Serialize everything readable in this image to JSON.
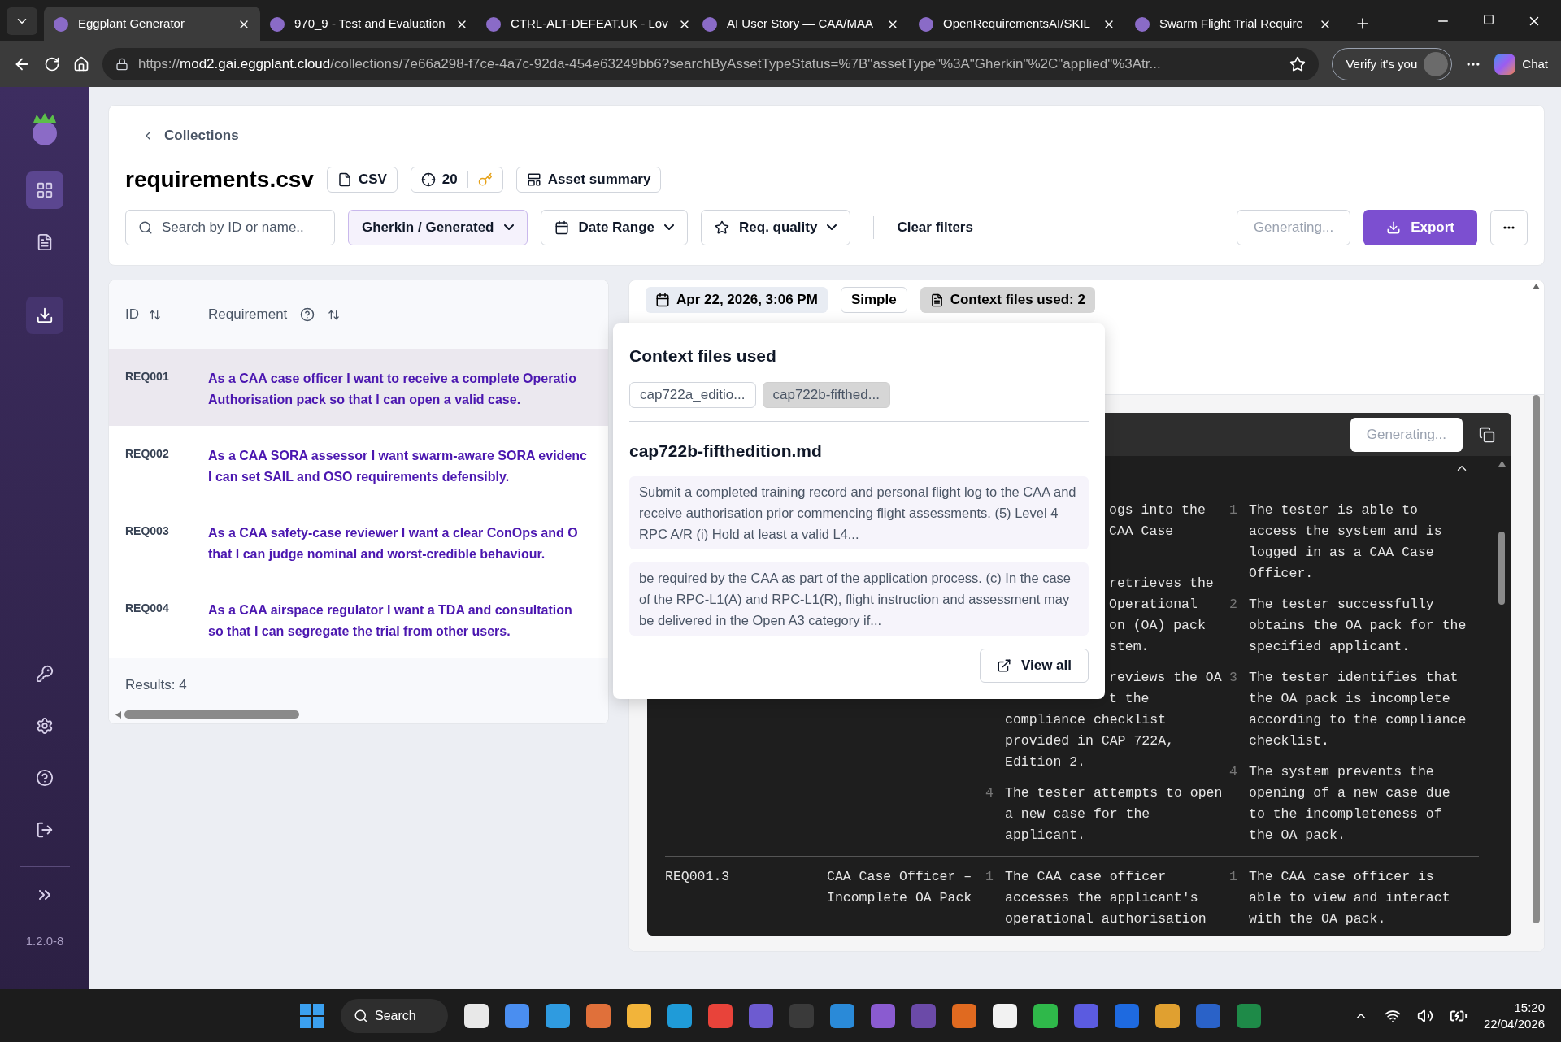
{
  "browser": {
    "tabs": [
      {
        "title": "Eggplant Generator",
        "selected": true
      },
      {
        "title": "970_9 - Test and Evaluation",
        "selected": false
      },
      {
        "title": "CTRL-ALT-DEFEAT.UK - Lov",
        "selected": false
      },
      {
        "title": "AI User Story — CAA/MAA",
        "selected": false
      },
      {
        "title": "OpenRequirementsAI/SKIL",
        "selected": false
      },
      {
        "title": "Swarm Flight Trial Require",
        "selected": false
      }
    ],
    "url_scheme": "https://",
    "url_host": "mod2.gai.eggplant.cloud",
    "url_rest": "/collections/7e66a298-f7ce-4a7c-92da-454e63249bb6?searchByAssetTypeStatus=%7B\"assetType\"%3A\"Gherkin\"%2C\"applied\"%3Atr...",
    "verify": "Verify it's you",
    "chat": "Chat"
  },
  "sidebar": {
    "items": [
      {
        "kind": "apps",
        "selected": true,
        "hovered": false
      },
      {
        "kind": "document",
        "selected": false,
        "hovered": false
      },
      {
        "kind": "import",
        "selected": false,
        "hovered": true
      }
    ],
    "bottom_items": [
      {
        "kind": "key"
      },
      {
        "kind": "settings"
      },
      {
        "kind": "help"
      },
      {
        "kind": "logout"
      }
    ],
    "version": "1.2.0-8"
  },
  "header": {
    "back": "Collections",
    "title": "requirements.csv",
    "format": "CSV",
    "count": "20",
    "summary": "Asset summary"
  },
  "filters": {
    "search_placeholder": "Search by ID or name..",
    "asset_type": "Gherkin / Generated",
    "date": "Date Range",
    "quality": "Req. quality",
    "clear": "Clear filters",
    "generating": "Generating...",
    "export": "Export"
  },
  "table": {
    "columns": [
      "ID",
      "Requirement"
    ],
    "rows": [
      {
        "id": "REQ001",
        "lines": [
          "As a CAA case officer I want to receive a complete Operatio",
          "Authorisation pack so that I can open a valid case."
        ],
        "selected": true
      },
      {
        "id": "REQ002",
        "lines": [
          "As a CAA SORA assessor I want swarm-aware SORA evidenc",
          "I can set SAIL and OSO requirements defensibly."
        ],
        "selected": false
      },
      {
        "id": "REQ003",
        "lines": [
          "As a CAA safety-case reviewer I want a clear ConOps and O",
          "that I can judge nominal and worst-credible behaviour."
        ],
        "selected": false
      },
      {
        "id": "REQ004",
        "lines": [
          "As a CAA airspace regulator I want a TDA and consultation",
          "so that I can segregate the trial from other users."
        ],
        "selected": false
      }
    ],
    "results": "Results: 4"
  },
  "detail": {
    "date": "Apr 22, 2026, 3:06 PM",
    "mode": "Simple",
    "context": "Context files used: 2",
    "generating": "Generating...",
    "rows": [
      {
        "steps": [
          {
            "cut_lines": [
              "ogs into the",
              "CAA Case"
            ]
          },
          {
            "cut_lines": [
              "retrieves the",
              "Operational",
              "on (OA) pack",
              "stem."
            ]
          },
          {
            "cut_lines": [
              "reviews the OA",
              "t the"
            ],
            "lines": [
              "compliance checklist",
              "provided in CAP 722A,",
              "Edition 2."
            ]
          },
          {
            "number": "4",
            "text": "The tester attempts to open a new case for the applicant."
          }
        ],
        "expected": [
          {
            "number": "1",
            "text": "The tester is able to access the system and is logged in as a CAA Case Officer."
          },
          {
            "number": "2",
            "text": "The tester successfully obtains the OA pack for the specified applicant."
          },
          {
            "number": "3",
            "text": "The tester identifies that the OA pack is incomplete according to the compliance checklist."
          },
          {
            "number": "4",
            "text": "The system prevents the opening of a new case due to the incompleteness of the OA pack."
          }
        ]
      },
      {
        "id": "REQ001.3",
        "title": "CAA Case Officer – Incomplete OA Pack",
        "steps": [
          {
            "number": "1",
            "text": "The CAA case officer accesses the applicant's operational authorisation"
          }
        ],
        "expected": [
          {
            "number": "1",
            "text": "The CAA case officer is able to view and interact with the OA pack."
          }
        ]
      }
    ]
  },
  "popup": {
    "title": "Context files used",
    "files": [
      {
        "name": "cap722a_editio...",
        "selected": false
      },
      {
        "name": "cap722b-fifthed...",
        "selected": true
      }
    ],
    "file_title": "cap722b-fifthedition.md",
    "snippets": [
      "Submit a completed training record and personal flight log to the CAA and receive authorisation prior commencing flight assessments. (5) Level 4 RPC A/R (i) Hold at least a valid L4...",
      "be required by the CAA as part of the application process. (c) In the case of the RPC-L1(A) and RPC-L1(R), flight instruction and assessment may be delivered in the Open A3 category if..."
    ],
    "view_all": "View all"
  },
  "taskbar": {
    "search": "Search",
    "time": "15:20",
    "date": "22/04/2026"
  }
}
